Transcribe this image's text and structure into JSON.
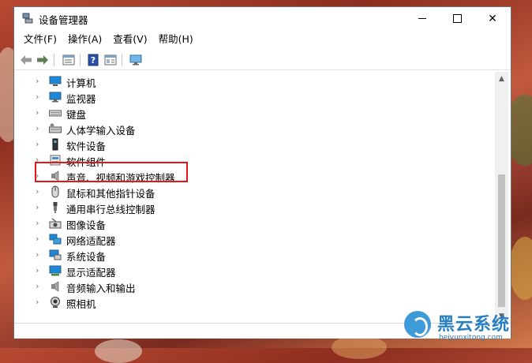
{
  "window": {
    "title": "设备管理器"
  },
  "menu": [
    {
      "label": "文件(F)"
    },
    {
      "label": "操作(A)"
    },
    {
      "label": "查看(V)"
    },
    {
      "label": "帮助(H)"
    }
  ],
  "toolbar": {
    "icons": [
      "back-arrow-icon",
      "forward-arrow-icon",
      "properties-icon",
      "help-icon",
      "details-icon",
      "monitor-icon"
    ]
  },
  "tree": {
    "items": [
      {
        "label": "计算机",
        "icon": "computer-icon"
      },
      {
        "label": "监视器",
        "icon": "monitor-icon"
      },
      {
        "label": "键盘",
        "icon": "keyboard-icon"
      },
      {
        "label": "人体学输入设备",
        "icon": "hid-icon"
      },
      {
        "label": "软件设备",
        "icon": "software-device-icon"
      },
      {
        "label": "软件组件",
        "icon": "software-component-icon"
      },
      {
        "label": "声音、视频和游戏控制器",
        "icon": "speaker-icon",
        "highlighted": true
      },
      {
        "label": "鼠标和其他指针设备",
        "icon": "mouse-icon"
      },
      {
        "label": "通用串行总线控制器",
        "icon": "usb-icon"
      },
      {
        "label": "图像设备",
        "icon": "imaging-icon"
      },
      {
        "label": "网络适配器",
        "icon": "network-icon"
      },
      {
        "label": "系统设备",
        "icon": "system-icon"
      },
      {
        "label": "显示适配器",
        "icon": "display-adapter-icon"
      },
      {
        "label": "音频输入和输出",
        "icon": "audio-io-icon"
      },
      {
        "label": "照相机",
        "icon": "camera-icon"
      }
    ]
  },
  "watermark": {
    "text": "黑云系统",
    "url": "heiyunxitong.com"
  },
  "colors": {
    "highlight_border": "#e01818",
    "monitor_blue": "#1e88d8"
  }
}
